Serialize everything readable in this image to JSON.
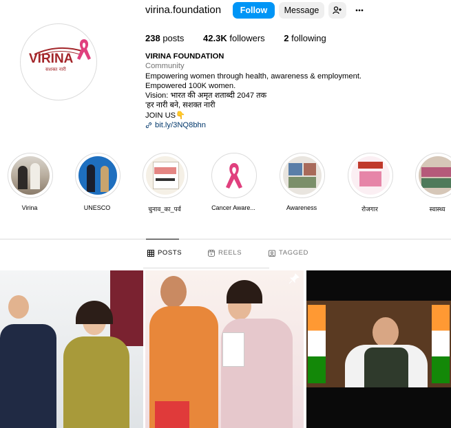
{
  "profile": {
    "username": "virina.foundation",
    "follow_label": "Follow",
    "message_label": "Message",
    "stats": {
      "posts_count": "238",
      "posts_label": "posts",
      "followers_count": "42.3K",
      "followers_label": "followers",
      "following_count": "2",
      "following_label": "following"
    },
    "bio": {
      "name": "VIRINA FOUNDATION",
      "category": "Community",
      "lines": [
        "Empowering women through health, awareness & employment.",
        "Empowered 100K women.",
        "Vision: भारत की अमृत शताब्दी 2047 तक",
        "'हर नारी बने, सशक्त नारी",
        "JOIN US👇"
      ],
      "link": "bit.ly/3NQ8bhn"
    },
    "logo": {
      "text": "VIRINA",
      "subtext": "सशक्त नारी",
      "brand_color": "#a3262a",
      "ribbon_color": "#e0407e"
    }
  },
  "highlights": [
    {
      "label": "Virina"
    },
    {
      "label": "UNESCO"
    },
    {
      "label": "चुनाव_का_पर्व"
    },
    {
      "label": "Cancer Aware..."
    },
    {
      "label": "Awareness"
    },
    {
      "label": "रोजगार"
    },
    {
      "label": "स्वास्थ्य"
    }
  ],
  "tabs": {
    "posts": "POSTS",
    "reels": "REELS",
    "tagged": "TAGGED"
  },
  "colors": {
    "accent": "#0095f6",
    "link": "#00376b",
    "muted": "#737373"
  }
}
